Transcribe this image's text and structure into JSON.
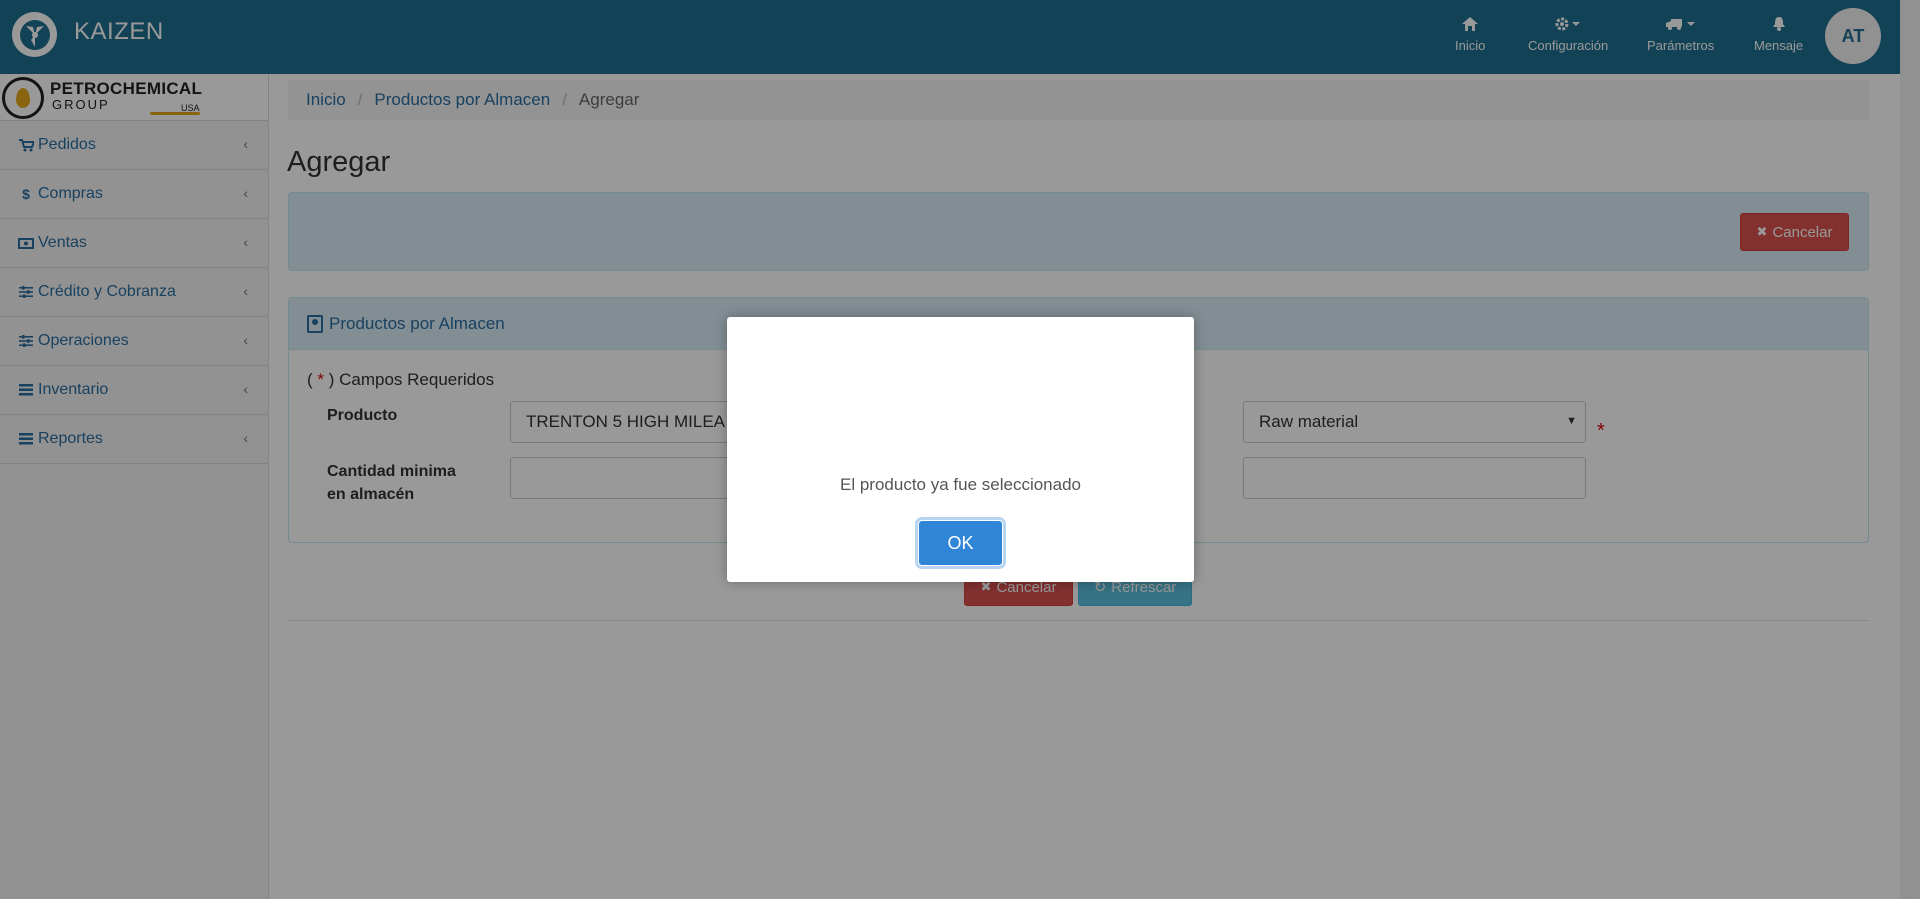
{
  "app": {
    "brand": "KAIZEN",
    "colors": {
      "topbar": "#1e6e8e",
      "link": "#2a6da0",
      "danger": "#d9534f",
      "info": "#5bc0de",
      "ok_button": "#3085d6"
    }
  },
  "topnav": {
    "items": [
      {
        "label": "Inicio",
        "icon": "home-icon"
      },
      {
        "label": "Configuración",
        "icon": "gear-icon"
      },
      {
        "label": "Parámetros",
        "icon": "truck-icon"
      },
      {
        "label": "Mensaje",
        "icon": "bell-icon"
      }
    ],
    "avatar_initials": "AT"
  },
  "sidebar": {
    "logo": {
      "title": "PETROCHEMICAL",
      "subtitle": "GROUP",
      "region": "USA"
    },
    "items": [
      {
        "label": "Pedidos",
        "icon": "cart-icon"
      },
      {
        "label": "Compras",
        "icon": "dollar-icon"
      },
      {
        "label": "Ventas",
        "icon": "money-icon"
      },
      {
        "label": "Crédito y Cobranza",
        "icon": "sliders-icon"
      },
      {
        "label": "Operaciones",
        "icon": "sliders-icon"
      },
      {
        "label": "Inventario",
        "icon": "list-icon"
      },
      {
        "label": "Reportes",
        "icon": "list-icon"
      }
    ]
  },
  "breadcrumb": {
    "home": "Inicio",
    "section": "Productos por Almacen",
    "current": "Agregar"
  },
  "page": {
    "title": "Agregar",
    "cancel_label": "Cancelar",
    "refresh_label": "Refrescar"
  },
  "panel": {
    "title": "Productos por Almacen",
    "required_prefix": "( ",
    "required_star": "*",
    "required_suffix": " ) Campos Requeridos",
    "product_label": "Producto",
    "product_value": "TRENTON 5 HIGH MILEA",
    "type_value": "Raw material",
    "min_qty_label_1": "Cantidad minima",
    "min_qty_label_2": "en almacén",
    "min_qty_value": "",
    "second_value": ""
  },
  "modal": {
    "message": "El producto ya fue seleccionado",
    "ok_label": "OK"
  }
}
